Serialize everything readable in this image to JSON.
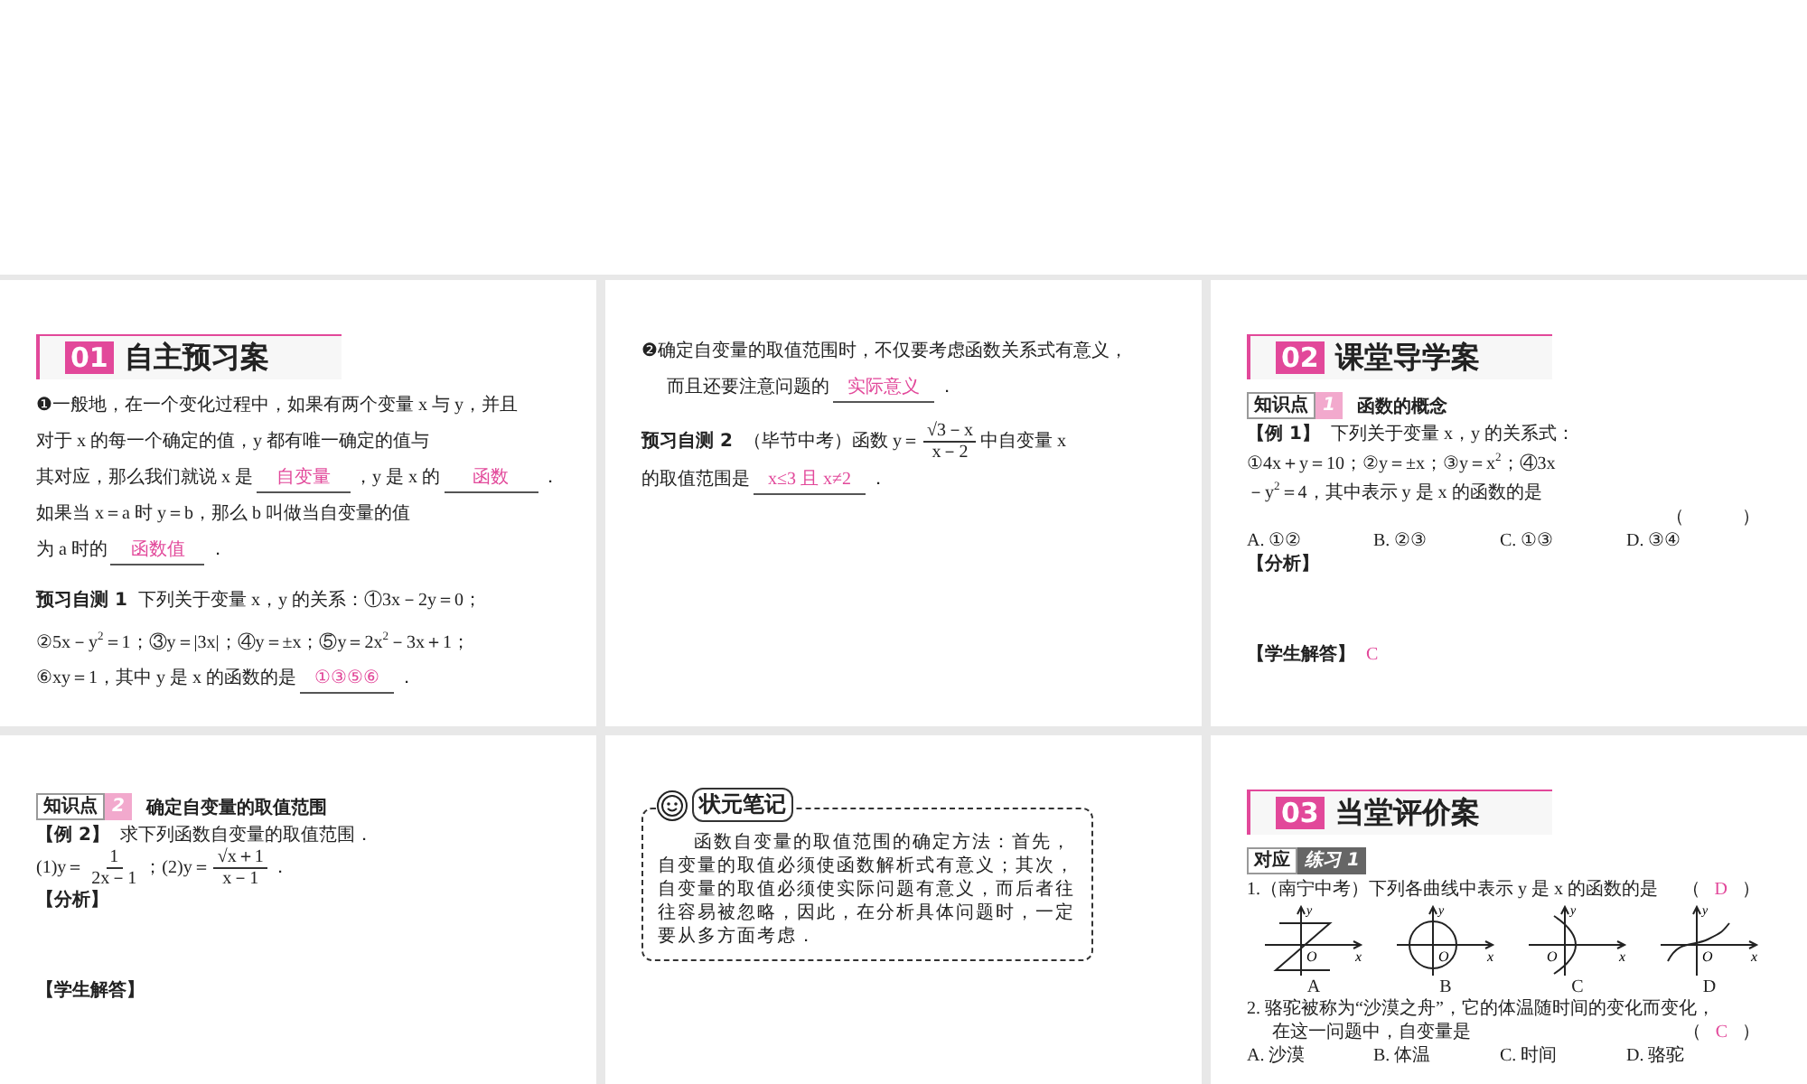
{
  "slides": [
    {
      "blocks": [
        {
          "kind": "heading",
          "number": "01",
          "title": "自主预习案"
        },
        {
          "kind": "para",
          "lines": [
            [
              {
                "kind": "text",
                "text": "❶一般地，在一个变化过程中，如果有两个变量 x 与 y，并且"
              }
            ],
            [
              {
                "kind": "text",
                "text": "对于 x 的每一个确定的值，y 都有唯一确定的值与"
              }
            ],
            [
              {
                "kind": "text",
                "text": "其对应，那么我们就说 x 是"
              },
              {
                "kind": "blank",
                "text": "自变量"
              },
              {
                "kind": "text",
                "text": "，y 是 x 的"
              },
              {
                "kind": "blank",
                "text": "函数"
              },
              {
                "kind": "text",
                "text": "．"
              }
            ],
            [
              {
                "kind": "text",
                "text": "如果当 x＝a 时 y＝b，那么 b 叫做当自变量的值"
              }
            ],
            [
              {
                "kind": "text",
                "text": "为 a 时的"
              },
              {
                "kind": "blank",
                "text": "函数值"
              },
              {
                "kind": "text",
                "text": "．"
              }
            ]
          ]
        },
        {
          "kind": "para",
          "lines": [
            [
              {
                "kind": "bold",
                "text": "预习自测 1"
              },
              {
                "kind": "text",
                "text": "下列关于变量 x，y 的关系：①3x－2y＝0；"
              }
            ],
            [
              {
                "kind": "text",
                "text": "②5x－y$^{2}$＝1；③y＝|3x|；④y＝±x；⑤y＝2x$^{2}$－3x＋1；"
              }
            ],
            [
              {
                "kind": "text",
                "text": "⑥xy＝1，其中 y 是 x 的函数的是"
              },
              {
                "kind": "blank",
                "text": "①③⑤⑥"
              },
              {
                "kind": "text",
                "text": "．"
              }
            ]
          ]
        }
      ]
    },
    {
      "blocks": [
        {
          "kind": "para",
          "lines": [
            [
              {
                "kind": "text",
                "text": "❷确定自变量的取值范围时，不仅要考虑函数关系式有意义，"
              }
            ],
            [
              {
                "kind": "indent"
              },
              {
                "kind": "text",
                "text": "而且还要注意问题的"
              },
              {
                "kind": "blank",
                "text": "实际意义"
              },
              {
                "kind": "text",
                "text": "．"
              }
            ]
          ]
        },
        {
          "kind": "para",
          "lines": [
            [
              {
                "kind": "bold",
                "text": "预习自测 2"
              },
              {
                "kind": "text",
                "text": "（毕节中考）函数 y＝"
              },
              {
                "kind": "frac",
                "num": "√3－x",
                "den": "x－2"
              },
              {
                "kind": "text",
                "text": "中自变量 x"
              }
            ],
            [
              {
                "kind": "text",
                "text": "的取值范围是"
              },
              {
                "kind": "blank",
                "text": "x≤3 且 x≠2"
              },
              {
                "kind": "text",
                "text": "．"
              }
            ]
          ]
        }
      ]
    },
    {
      "blocks": [
        {
          "kind": "heading",
          "number": "02",
          "title": "课堂导学案"
        },
        {
          "kind": "topic_tag",
          "label": "知识点",
          "index": "1",
          "title": "函数的概念"
        },
        {
          "kind": "question",
          "lines": [
            [
              {
                "kind": "bold",
                "text": "【例 1】"
              },
              {
                "kind": "text",
                "text": "下列关于变量 x，y 的关系式："
              }
            ],
            [
              {
                "kind": "text",
                "text": "①4x＋y＝10；②y＝±x；③y＝x$^{2}$；④3x"
              }
            ],
            [
              {
                "kind": "text",
                "text": "－y$^{2}$＝4，其中表示 y 是 x 的函数的是"
              }
            ],
            [
              {
                "kind": "paren",
                "open": "（",
                "close": "）"
              }
            ]
          ]
        },
        {
          "kind": "options",
          "items": [
            "A. ①②",
            "B. ②③",
            "C. ①③",
            "D. ③④"
          ]
        },
        {
          "kind": "label",
          "text": "【分析】"
        },
        {
          "kind": "question",
          "lines": [
            [
              {
                "kind": "bold",
                "text": "【学生解答】"
              },
              {
                "kind": "answer",
                "text": "C"
              }
            ]
          ]
        }
      ]
    },
    {
      "blocks": [
        {
          "kind": "topic_tag",
          "label": "知识点",
          "index": "2",
          "title": "确定自变量的取值范围"
        },
        {
          "kind": "question",
          "lines": [
            [
              {
                "kind": "bold",
                "text": "【例 2】"
              },
              {
                "kind": "text",
                "text": "求下列函数自变量的取值范围．"
              }
            ],
            [
              {
                "kind": "text",
                "text": "(1)y＝"
              },
              {
                "kind": "frac",
                "num": "1",
                "den": "2x－1"
              },
              {
                "kind": "text",
                "text": "；(2)y＝"
              },
              {
                "kind": "frac",
                "num": "√x＋1",
                "den": "x－1"
              },
              {
                "kind": "text",
                "text": "．"
              }
            ]
          ]
        },
        {
          "kind": "label",
          "text": "【分析】"
        },
        {
          "kind": "label",
          "text": "【学生解答】"
        }
      ]
    },
    {
      "blocks": [
        {
          "kind": "note",
          "title": "状元笔记",
          "text": "函数自变量的取值范围的确定方法：首先，自变量的取值必须使函数解析式有意义；其次，自变量的取值必须使实际问题有意义，而后者往往容易被忽略，因此，在分析具体问题时，一定要从多方面考虑．"
        }
      ]
    },
    {
      "blocks": [
        {
          "kind": "heading",
          "number": "03",
          "title": "当堂评价案"
        },
        {
          "kind": "practice_tag",
          "label": "对应",
          "index": "练习 1"
        },
        {
          "kind": "question",
          "lines": [
            [
              {
                "kind": "text",
                "text": "1.（南宁中考）下列各曲线中表示 y 是 x 的函数的是"
              },
              {
                "kind": "paren",
                "open": "（",
                "answer": "D",
                "close": "）"
              }
            ]
          ]
        },
        {
          "kind": "graphs",
          "items": [
            {
              "label": "A",
              "origin": "O",
              "x_axis": "x",
              "y_axis": "y"
            },
            {
              "label": "B",
              "origin": "O",
              "x_axis": "x",
              "y_axis": "y"
            },
            {
              "label": "C",
              "origin": "O",
              "x_axis": "x",
              "y_axis": "y"
            },
            {
              "label": "D",
              "origin": "O",
              "x_axis": "x",
              "y_axis": "y"
            }
          ]
        },
        {
          "kind": "question",
          "lines": [
            [
              {
                "kind": "text",
                "text": "2. 骆驼被称为“沙漠之舟”，它的体温随时间的变化而变化，"
              }
            ],
            [
              {
                "kind": "indent"
              },
              {
                "kind": "text",
                "text": "在这一问题中，自变量是"
              },
              {
                "kind": "paren",
                "open": "（",
                "answer": "C",
                "close": "）"
              }
            ]
          ]
        },
        {
          "kind": "options",
          "items": [
            "A. 沙漠",
            "B. 体温",
            "C. 时间",
            "D. 骆驼"
          ]
        }
      ]
    }
  ]
}
